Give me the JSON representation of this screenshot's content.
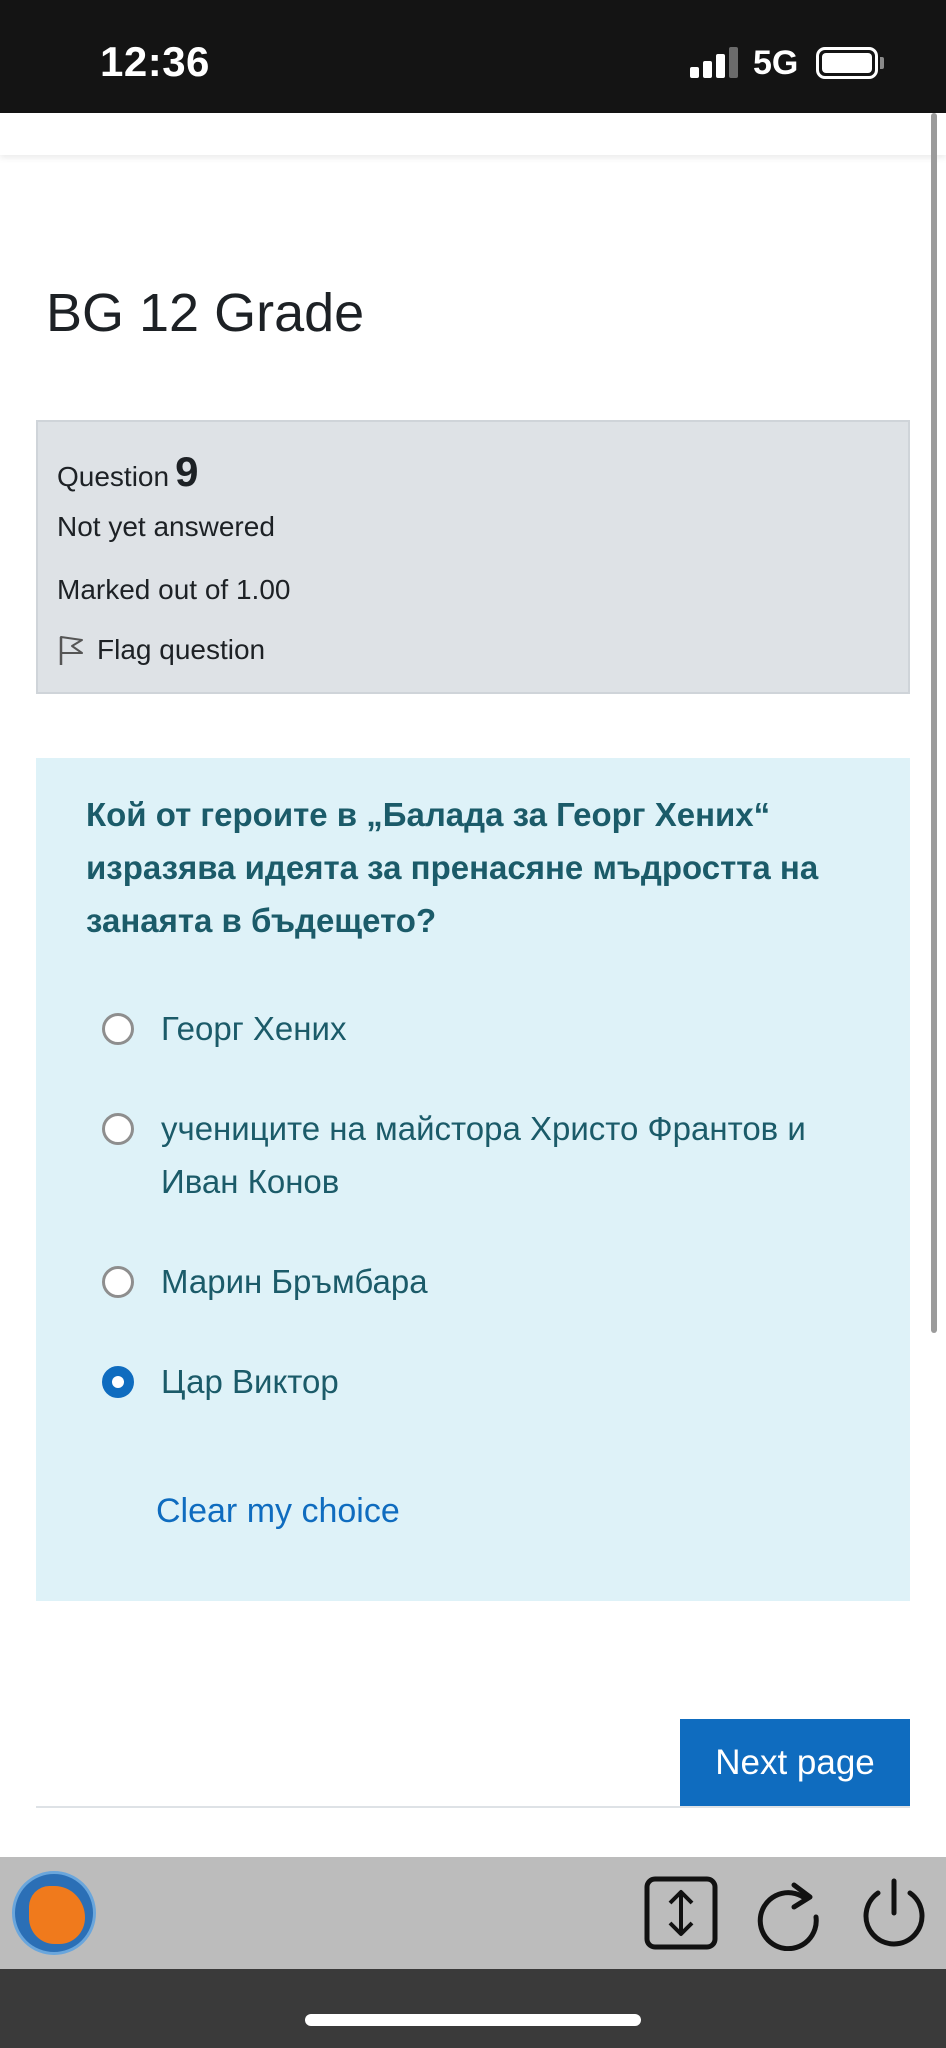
{
  "status_bar": {
    "time": "12:36",
    "network": "5G"
  },
  "page": {
    "title": "BG 12 Grade"
  },
  "question_info": {
    "label": "Question",
    "number": "9",
    "state": "Not yet answered",
    "grade": "Marked out of 1.00",
    "flag_label": "Flag question"
  },
  "question": {
    "text": "Кой от героите в „Балада за Георг Хених“ изразява идеята за пренасяне мъдростта на занаята в бъдещето?",
    "options": [
      {
        "label": "Георг Хених",
        "selected": false
      },
      {
        "label": "учениците на майстора Христо Франтов и Иван Конов",
        "selected": false
      },
      {
        "label": "Марин Бръмбара",
        "selected": false
      },
      {
        "label": "Цар Виктор",
        "selected": true
      }
    ],
    "clear_label": "Clear my choice"
  },
  "navigation": {
    "next_label": "Next page"
  },
  "toolbar": {
    "icons": [
      "app-logo-icon",
      "scroll-toggle-icon",
      "reload-icon",
      "power-icon"
    ]
  },
  "colors": {
    "accent": "#0f6cbf",
    "question_bg": "#def2f8",
    "info_bg": "#dee2e6",
    "question_text": "#1b5b69"
  }
}
